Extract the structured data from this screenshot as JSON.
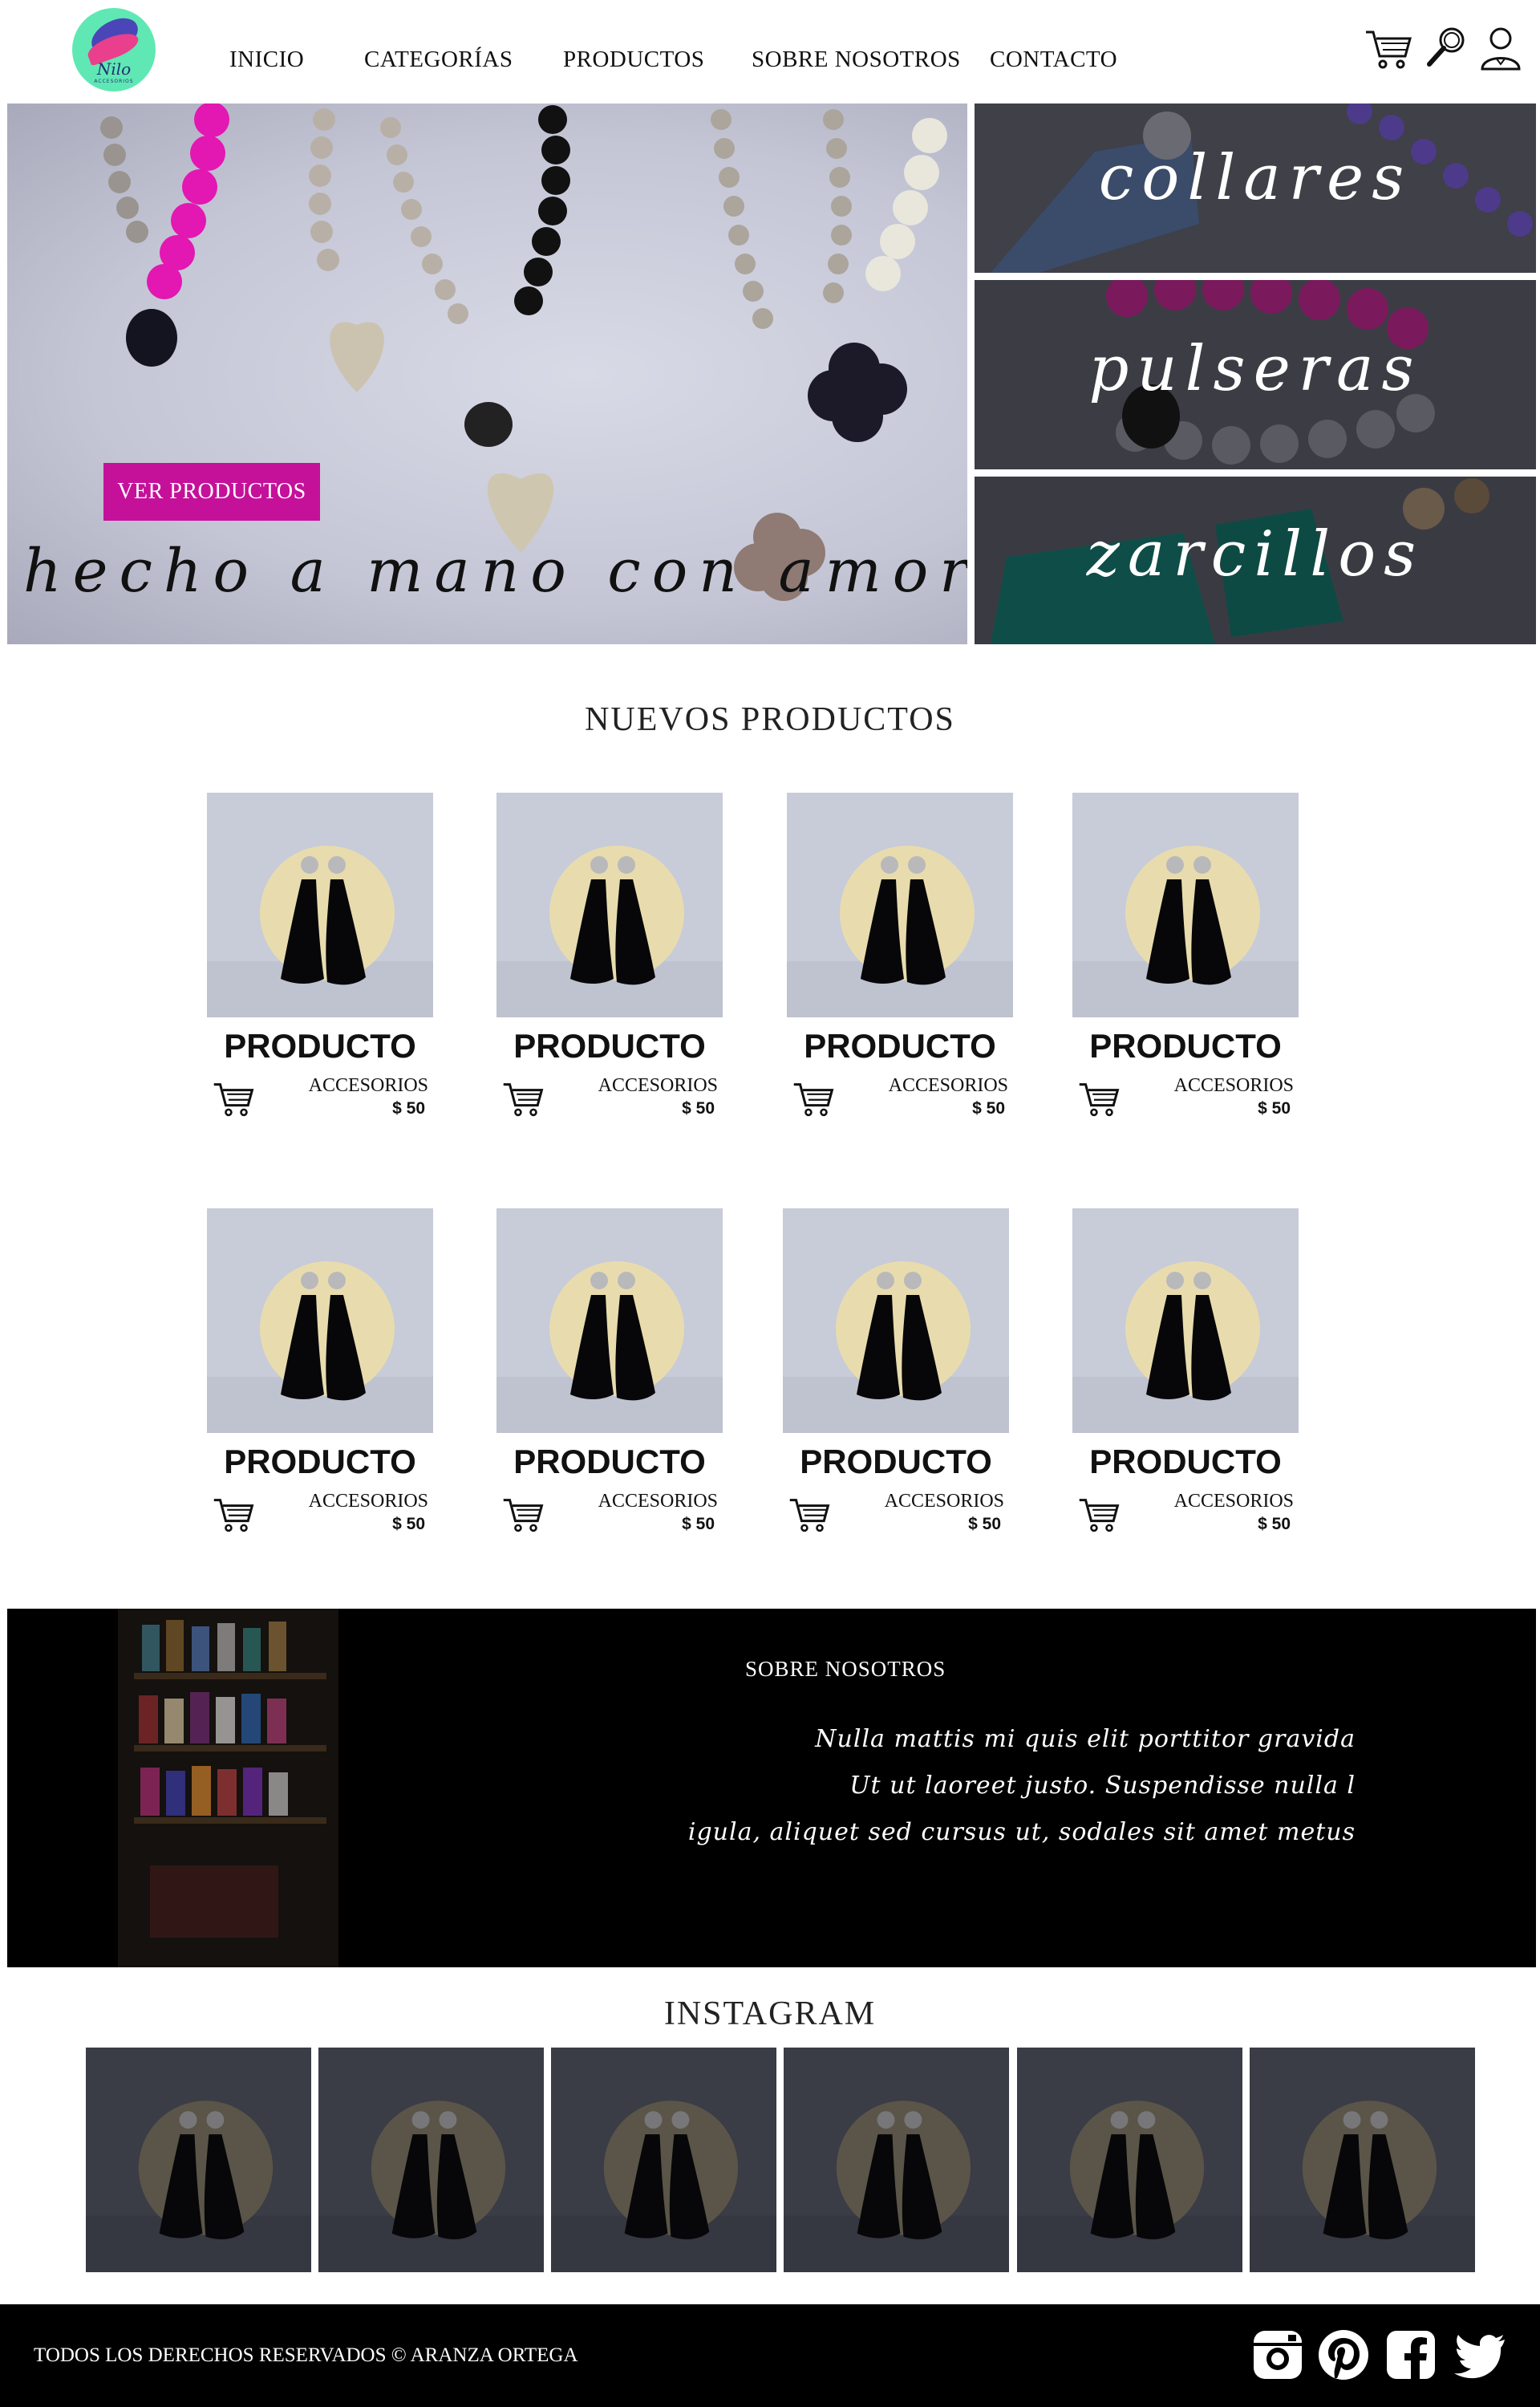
{
  "header": {
    "logo_text": "Nilo",
    "logo_subtext": "ACCESORIOS",
    "nav": [
      "INICIO",
      "CATEGORÍAS",
      "PRODUCTOS",
      "SOBRE NOSOTROS",
      "CONTACTO"
    ],
    "icons": [
      "cart-icon",
      "search-icon",
      "user-icon"
    ]
  },
  "hero": {
    "cta_label": "VER PRODUCTOS",
    "tagline": "hecho a mano con amor",
    "accent_color": "#c5119a"
  },
  "categories": [
    "collares",
    "pulseras",
    "zarcillos"
  ],
  "new_products": {
    "title": "NUEVOS PRODUCTOS",
    "items": [
      {
        "name": "PRODUCTO",
        "category": "ACCESORIOS",
        "price": "$ 50"
      },
      {
        "name": "PRODUCTO",
        "category": "ACCESORIOS",
        "price": "$ 50"
      },
      {
        "name": "PRODUCTO",
        "category": "ACCESORIOS",
        "price": "$ 50"
      },
      {
        "name": "PRODUCTO",
        "category": "ACCESORIOS",
        "price": "$ 50"
      },
      {
        "name": "PRODUCTO",
        "category": "ACCESORIOS",
        "price": "$ 50"
      },
      {
        "name": "PRODUCTO",
        "category": "ACCESORIOS",
        "price": "$ 50"
      },
      {
        "name": "PRODUCTO",
        "category": "ACCESORIOS",
        "price": "$ 50"
      },
      {
        "name": "PRODUCTO",
        "category": "ACCESORIOS",
        "price": "$ 50"
      }
    ]
  },
  "about": {
    "title": "SOBRE NOSOTROS",
    "lines": [
      "Nulla mattis mi quis elit porttitor gravida",
      "Ut ut laoreet justo. Suspendisse nulla l",
      "igula, aliquet sed cursus ut, sodales sit amet metus"
    ]
  },
  "instagram": {
    "title": "INSTAGRAM",
    "count": 6
  },
  "footer": {
    "copyright": "TODOS LOS DERECHOS RESERVADOS  © ARANZA ORTEGA",
    "social": [
      "instagram-icon",
      "pinterest-icon",
      "facebook-icon",
      "twitter-icon"
    ]
  }
}
